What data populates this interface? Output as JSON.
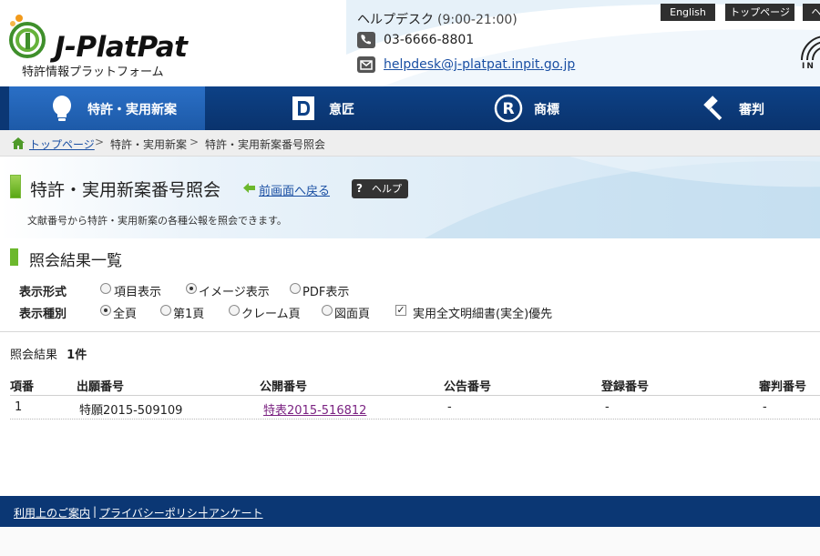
{
  "header": {
    "logo_text": "J-PlatPat",
    "logo_subtitle": "特許情報プラットフォーム",
    "helpdesk": {
      "title": "ヘルプデスク",
      "hours": "(9:00-21:00)",
      "phone": "03-6666-8801",
      "email": "helpdesk@j-platpat.inpit.go.jp"
    },
    "top_links": [
      "English",
      "トップページ",
      "ヘ"
    ],
    "inpit_fragment": "IN"
  },
  "nav": {
    "items": [
      {
        "label": "特許・実用新案",
        "icon": "lightbulb-icon",
        "active": true
      },
      {
        "label": "意匠",
        "icon": "design-d-icon",
        "active": false
      },
      {
        "label": "商標",
        "icon": "trademark-r-icon",
        "active": false
      },
      {
        "label": "審判",
        "icon": "gavel-icon",
        "active": false
      }
    ]
  },
  "breadcrumb": {
    "items": [
      "トップページ",
      "特許・実用新案",
      "特許・実用新案番号照会"
    ],
    "separator": ">"
  },
  "page": {
    "title": "特許・実用新案番号照会",
    "back_link": "前画面へ戻る",
    "help_label": "ヘルプ",
    "help_symbol": "?",
    "description": "文献番号から特許・実用新案の各種公報を照会できます。"
  },
  "results": {
    "section_title": "照会結果一覧",
    "display_format": {
      "label": "表示形式",
      "options": [
        "項目表示",
        "イメージ表示",
        "PDF表示"
      ],
      "selected": "イメージ表示"
    },
    "display_type": {
      "label": "表示種別",
      "options": [
        "全頁",
        "第1頁",
        "クレーム頁",
        "図面頁"
      ],
      "selected": "全頁",
      "checkbox_label": "実用全文明細書(実全)優先",
      "checkbox_checked": true
    },
    "count_label": "照会結果",
    "count_value": "1件",
    "columns": [
      "項番",
      "出願番号",
      "公開番号",
      "公告番号",
      "登録番号",
      "審判番号"
    ],
    "rows": [
      {
        "no": "1",
        "application": "特願2015-509109",
        "publication": "特表2015-516812",
        "examined": "-",
        "registration": "-",
        "appeal": "-"
      }
    ]
  },
  "footer": {
    "links": [
      "利用上のご案内",
      "プライバシーポリシー",
      "アンケート"
    ],
    "separator": "|"
  },
  "colors": {
    "nav_bg": "#0d4186",
    "nav_active": "#2a6fc6",
    "accent_green": "#6cb82c",
    "footer_bg": "#0b3774",
    "link": "#1a4fa3",
    "visited_link": "#7b2382"
  }
}
